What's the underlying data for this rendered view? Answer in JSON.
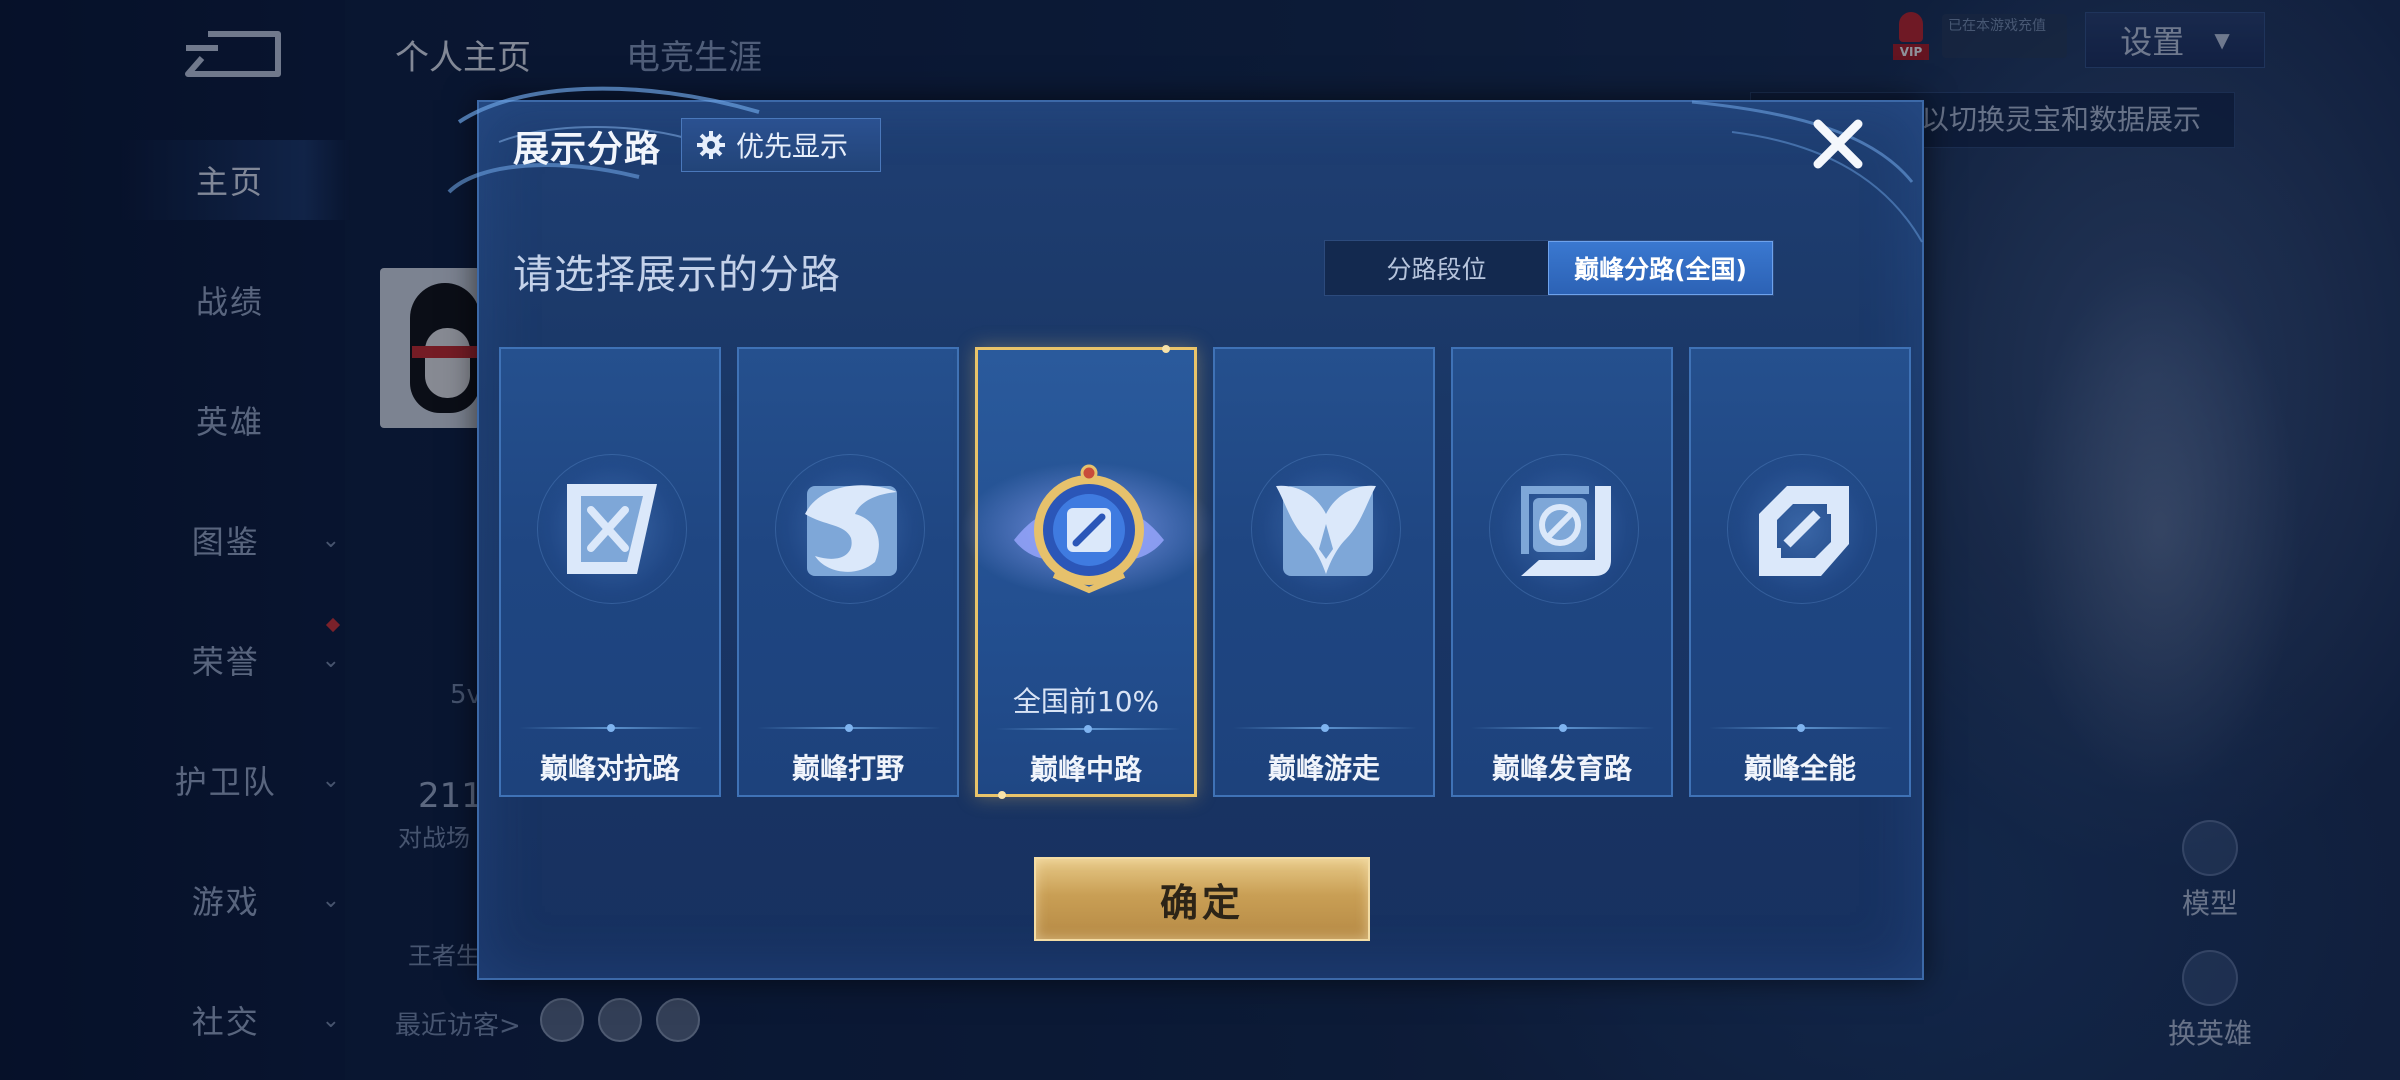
{
  "page": {
    "top_tabs": [
      {
        "label": "个人主页",
        "active": true
      },
      {
        "label": "电竞生涯",
        "active": false
      }
    ],
    "settings_label": "设置",
    "vip_label": "VIP",
    "game_status": "已在本游戏充值",
    "tip_text": "以切换灵宝和数据展示",
    "visitors_label": "最近访客>",
    "bg_fragments": {
      "count_value": "211",
      "count_label": "对战场",
      "left_small": "5v",
      "title_small": "王者生"
    },
    "side_controls": [
      {
        "label": "模型"
      },
      {
        "label": "换英雄"
      }
    ]
  },
  "nav": {
    "items": [
      {
        "label": "主页",
        "active": true,
        "chevron": false
      },
      {
        "label": "战绩",
        "active": false,
        "chevron": false
      },
      {
        "label": "英雄",
        "active": false,
        "chevron": false
      },
      {
        "label": "图鉴",
        "active": false,
        "chevron": true
      },
      {
        "label": "荣誉",
        "active": false,
        "chevron": true
      },
      {
        "label": "护卫队",
        "active": false,
        "chevron": true
      },
      {
        "label": "游戏",
        "active": false,
        "chevron": true
      },
      {
        "label": "社交",
        "active": false,
        "chevron": true
      }
    ]
  },
  "modal": {
    "title": "展示分路",
    "pref_button": {
      "label": "优先显示",
      "icon": "gear-icon"
    },
    "close_icon": "close-icon",
    "subtitle": "请选择展示的分路",
    "segments": [
      {
        "label": "分路段位",
        "active": false
      },
      {
        "label": "巅峰分路(全国)",
        "active": true
      }
    ],
    "cards": [
      {
        "name": "巅峰对抗路",
        "icon": "crossed-swords-emblem",
        "selected": false,
        "rank": ""
      },
      {
        "name": "巅峰打野",
        "icon": "dragon-emblem",
        "selected": false,
        "rank": ""
      },
      {
        "name": "巅峰中路",
        "icon": "mid-lane-gold-badge",
        "selected": true,
        "rank": "全国前10%"
      },
      {
        "name": "巅峰游走",
        "icon": "wings-emblem",
        "selected": false,
        "rank": ""
      },
      {
        "name": "巅峰发育路",
        "icon": "bow-emblem",
        "selected": false,
        "rank": ""
      },
      {
        "name": "巅峰全能",
        "icon": "allround-emblem",
        "selected": false,
        "rank": ""
      }
    ],
    "confirm_label": "确定"
  },
  "colors": {
    "accent_gold": "#e9c46a",
    "active_tab_blue": "#2c62b5",
    "modal_bg": "#1a3766"
  }
}
